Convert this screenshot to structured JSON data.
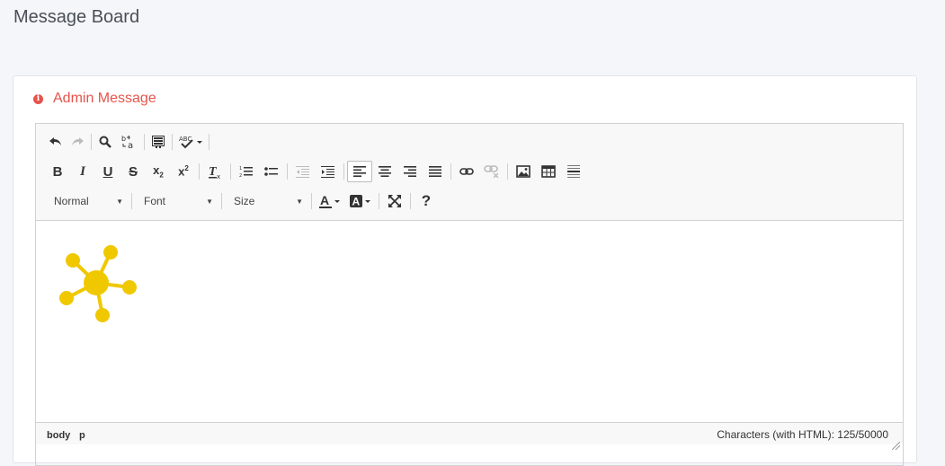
{
  "page": {
    "title": "Message Board"
  },
  "panel": {
    "title": "Admin Message",
    "accent": "#e5534b"
  },
  "toolbar": {
    "row1": [
      "undo-icon",
      "redo-icon",
      "find-icon",
      "replace-icon",
      "select-all-icon",
      "spell-check-icon"
    ],
    "row2": [
      "bold-icon",
      "italic-icon",
      "underline-icon",
      "strikethrough-icon",
      "subscript-icon",
      "superscript-icon",
      "remove-format-icon",
      "numbered-list-icon",
      "bulleted-list-icon",
      "decrease-indent-icon",
      "increase-indent-icon",
      "align-left-icon",
      "align-center-icon",
      "align-right-icon",
      "justify-icon",
      "link-icon",
      "unlink-icon",
      "image-icon",
      "table-icon",
      "horizontal-line-icon"
    ],
    "format_combo": "Normal",
    "font_combo": "Font",
    "size_combo": "Size",
    "row3": [
      "text-color-icon",
      "background-color-icon",
      "maximize-icon",
      "help-icon"
    ]
  },
  "content": {
    "image": "molecule-logo",
    "logo_color": "#f0c800"
  },
  "status": {
    "path": [
      "body",
      "p"
    ],
    "char_count": "Characters (with HTML): 125/50000"
  }
}
